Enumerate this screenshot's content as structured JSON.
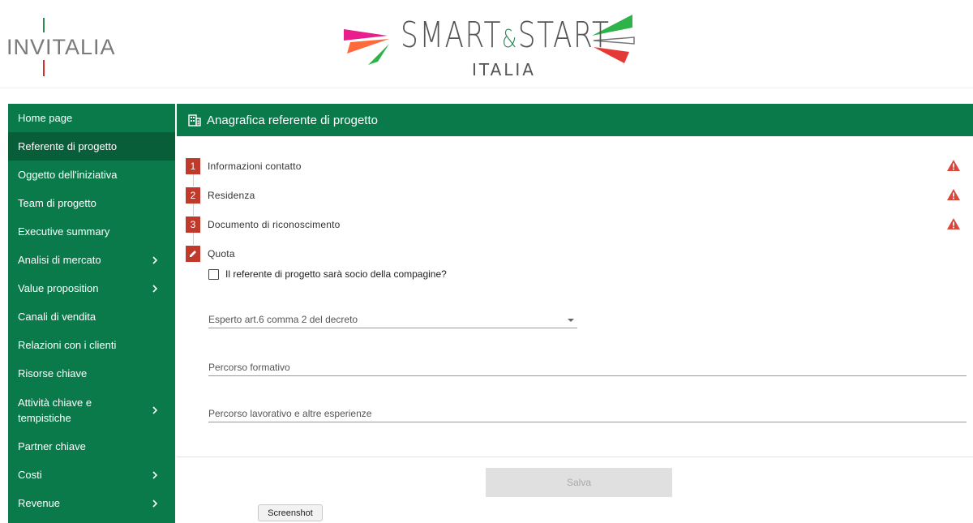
{
  "brand": {
    "org_logo": "INVITALIA",
    "product_logo_line1": "SMART",
    "product_logo_amp": "&",
    "product_logo_line1b": "START",
    "product_logo_line2": "ITALIA"
  },
  "sidebar": {
    "items": [
      {
        "label": "Home page",
        "chevron": false
      },
      {
        "label": "Referente di progetto",
        "chevron": false,
        "active": true
      },
      {
        "label": "Oggetto dell'iniziativa",
        "chevron": false
      },
      {
        "label": "Team di progetto",
        "chevron": false
      },
      {
        "label": "Executive summary",
        "chevron": false
      },
      {
        "label": "Analisi di mercato",
        "chevron": true
      },
      {
        "label": "Value proposition",
        "chevron": true
      },
      {
        "label": "Canali di vendita",
        "chevron": false
      },
      {
        "label": "Relazioni con i clienti",
        "chevron": false
      },
      {
        "label": "Risorse chiave",
        "chevron": false
      },
      {
        "label": "Attività chiave e tempistiche",
        "chevron": true
      },
      {
        "label": "Partner chiave",
        "chevron": false
      },
      {
        "label": "Costi",
        "chevron": true
      },
      {
        "label": "Revenue",
        "chevron": true
      }
    ]
  },
  "panel": {
    "icon": "building-icon",
    "title": "Anagrafica referente di progetto"
  },
  "steps": [
    {
      "badge": "1",
      "label": "Informazioni contatto",
      "warning": true
    },
    {
      "badge": "2",
      "label": "Residenza",
      "warning": true
    },
    {
      "badge": "3",
      "label": "Documento di riconoscimento",
      "warning": true
    },
    {
      "badge_icon": "pencil-icon",
      "label": "Quota",
      "warning": false
    }
  ],
  "form": {
    "checkbox_label": "Il referente di progetto sarà socio della compagine?",
    "checkbox_checked": false,
    "select_placeholder": "Esperto art.6 comma 2 del decreto",
    "field1_placeholder": "Percorso formativo",
    "field2_placeholder": "Percorso lavorativo e altre esperienze"
  },
  "actions": {
    "save_label": "Salva",
    "save_enabled": false
  },
  "overlay": {
    "screenshot_label": "Screenshot"
  },
  "colors": {
    "primary_green": "#0b7a4b",
    "active_green": "#085e39",
    "step_red": "#c0392b",
    "warning_red": "#d9463a"
  }
}
